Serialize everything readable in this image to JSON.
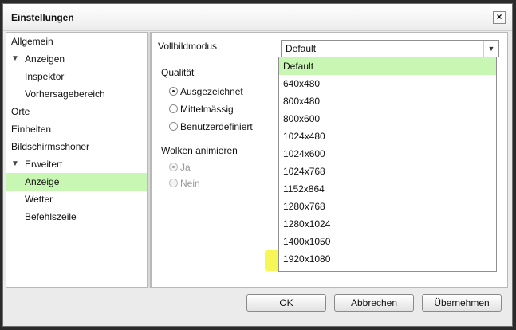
{
  "window": {
    "title": "Einstellungen",
    "close_label": "×"
  },
  "tree": {
    "items": [
      {
        "label": "Allgemein",
        "level": 0,
        "expandable": false,
        "selected": false
      },
      {
        "label": "Anzeigen",
        "level": 0,
        "expandable": true,
        "selected": false
      },
      {
        "label": "Inspektor",
        "level": 1,
        "expandable": false,
        "selected": false
      },
      {
        "label": "Vorhersagebereich",
        "level": 1,
        "expandable": false,
        "selected": false
      },
      {
        "label": "Orte",
        "level": 0,
        "expandable": false,
        "selected": false
      },
      {
        "label": "Einheiten",
        "level": 0,
        "expandable": false,
        "selected": false
      },
      {
        "label": "Bildschirmschoner",
        "level": 0,
        "expandable": false,
        "selected": false
      },
      {
        "label": "Erweitert",
        "level": 0,
        "expandable": true,
        "selected": false
      },
      {
        "label": "Anzeige",
        "level": 1,
        "expandable": false,
        "selected": true
      },
      {
        "label": "Wetter",
        "level": 1,
        "expandable": false,
        "selected": false
      },
      {
        "label": "Befehlszeile",
        "level": 1,
        "expandable": false,
        "selected": false
      }
    ],
    "expand_glyph": "▼"
  },
  "settings": {
    "fullscreen_label": "Vollbildmodus",
    "fullscreen_value": "Default",
    "quality_label": "Qualität",
    "quality_options": [
      "Ausgezeichnet",
      "Mittelmässig",
      "Benutzerdefiniert"
    ],
    "quality_selected": 0,
    "clouds_label": "Wolken animieren",
    "clouds_options": [
      "Ja",
      "Nein"
    ],
    "clouds_selected": 0
  },
  "dropdown": {
    "options": [
      "Default",
      "640x480",
      "800x480",
      "800x600",
      "1024x480",
      "1024x600",
      "1024x768",
      "1152x864",
      "1280x768",
      "1280x1024",
      "1400x1050",
      "1920x1080"
    ],
    "selected_index": 0,
    "highlighted_option": "1920x1080"
  },
  "buttons": {
    "ok": "OK",
    "cancel": "Abbrechen",
    "apply": "Übernehmen"
  },
  "colors": {
    "selection": "#c7f7b2",
    "highlight": "#f5f53a"
  }
}
